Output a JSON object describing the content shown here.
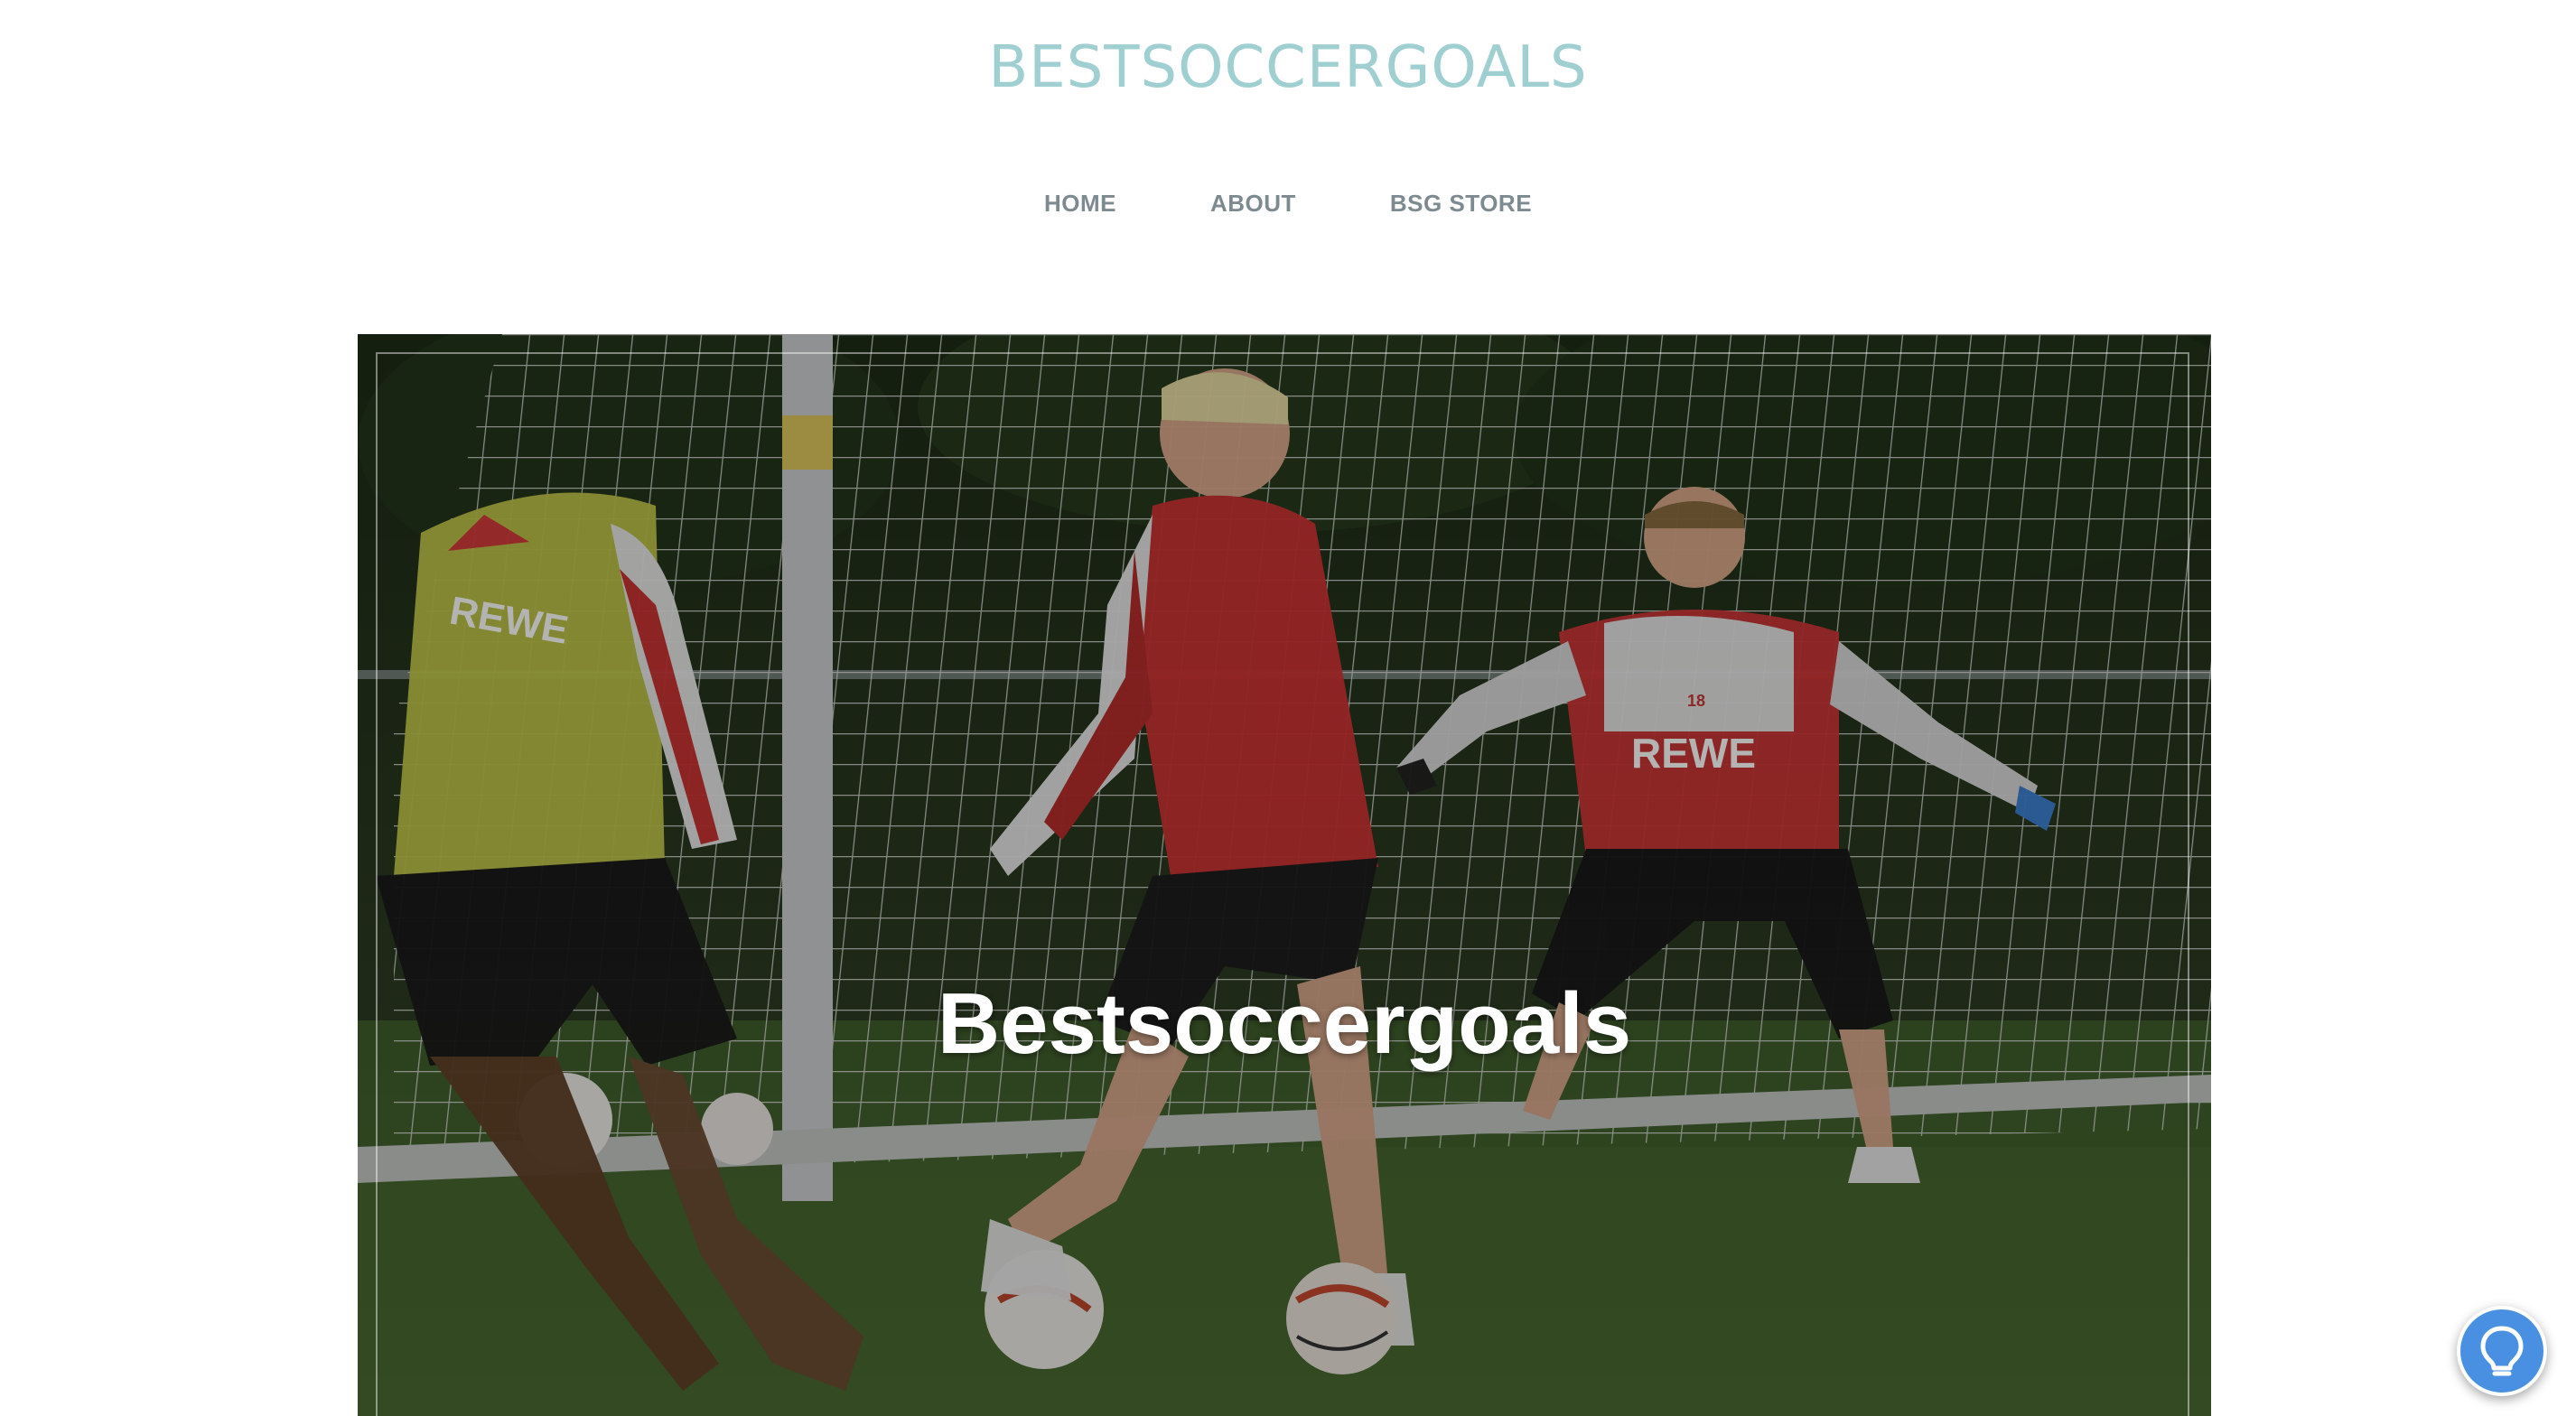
{
  "site": {
    "title": "BESTSOCCERGOALS"
  },
  "nav": {
    "items": [
      {
        "label": "HOME"
      },
      {
        "label": "ABOUT"
      },
      {
        "label": "BSG STORE"
      }
    ]
  },
  "hero": {
    "heading": "Bestsoccergoals",
    "jersey_sponsor_text": "REWE",
    "keeper_number": "18"
  },
  "help_widget": {
    "icon": "lightbulb-icon"
  },
  "colors": {
    "title": "#9fcfd1",
    "nav_text": "#7d8a90",
    "help_button": "#4a90e2"
  }
}
